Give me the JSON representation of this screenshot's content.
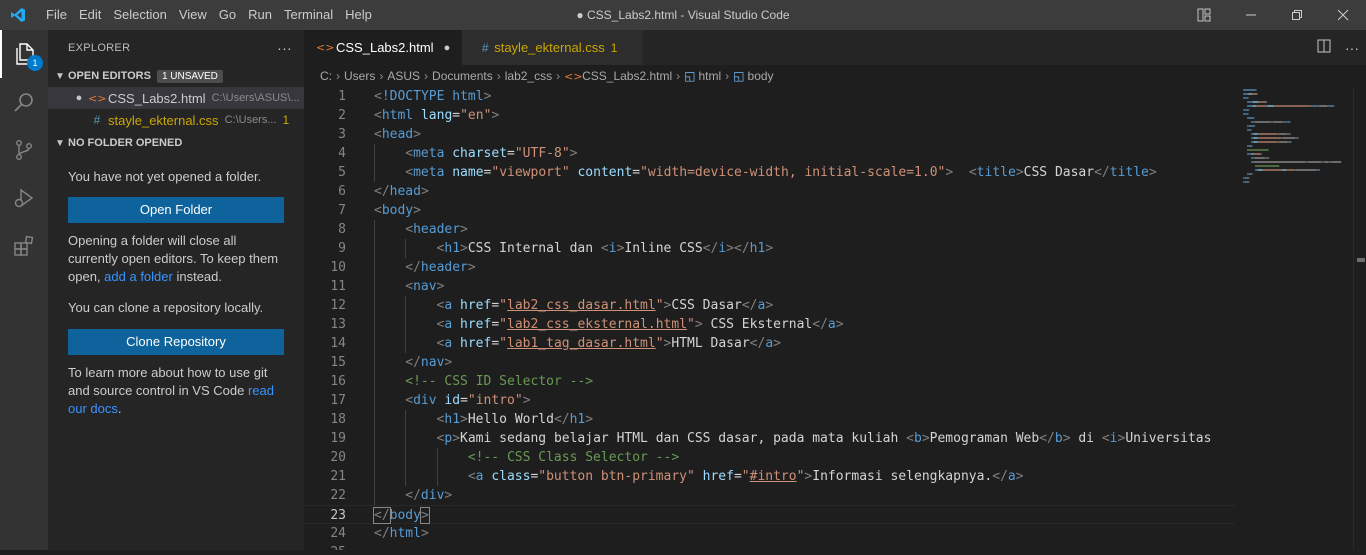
{
  "menu": [
    "File",
    "Edit",
    "Selection",
    "View",
    "Go",
    "Run",
    "Terminal",
    "Help"
  ],
  "window_title": "● CSS_Labs2.html - Visual Studio Code",
  "activity": {
    "explorer_badge": "1"
  },
  "sidebar": {
    "title": "EXPLORER",
    "more": "···",
    "open_editors": {
      "label": "OPEN EDITORS",
      "badge": "1 UNSAVED",
      "items": [
        {
          "name": "CSS_Labs2.html",
          "path": "C:\\Users\\ASUS\\..."
        },
        {
          "name": "stayle_ekternal.css",
          "path": "C:\\Users...",
          "problems": "1"
        }
      ]
    },
    "no_folder": {
      "label": "NO FOLDER OPENED",
      "msg1": "You have not yet opened a folder.",
      "open_btn": "Open Folder",
      "msg2_a": "Opening a folder will close all currently open editors. To keep them open,",
      "msg2_link": "add a folder",
      "msg2_b": "instead.",
      "msg3": "You can clone a repository locally.",
      "clone_btn": "Clone Repository",
      "msg4_a": "To learn more about how to use git and source control in VS Code",
      "msg4_link": "read our docs",
      "msg4_b": "."
    }
  },
  "tabs": [
    {
      "label": "CSS_Labs2.html",
      "state": "●"
    },
    {
      "label": "stayle_ekternal.css",
      "problems": "1"
    }
  ],
  "breadcrumbs": [
    "C:",
    "Users",
    "ASUS",
    "Documents",
    "lab2_css",
    "CSS_Labs2.html",
    "html",
    "body"
  ],
  "editor": {
    "current_line": 23,
    "lines": [
      {
        "n": "1",
        "indent": 0,
        "tokens": [
          [
            "br",
            "<"
          ],
          [
            "doc",
            "!DOCTYPE "
          ],
          [
            "tag",
            "html"
          ],
          [
            "br",
            ">"
          ]
        ]
      },
      {
        "n": "2",
        "indent": 0,
        "tokens": [
          [
            "br",
            "<"
          ],
          [
            "tag",
            "html"
          ],
          [
            "txt",
            " "
          ],
          [
            "attr",
            "lang"
          ],
          [
            "txt",
            "="
          ],
          [
            "str",
            "\"en\""
          ],
          [
            "br",
            ">"
          ]
        ]
      },
      {
        "n": "3",
        "indent": 0,
        "tokens": [
          [
            "br",
            "<"
          ],
          [
            "tag",
            "head"
          ],
          [
            "br",
            ">"
          ]
        ]
      },
      {
        "n": "4",
        "indent": 1,
        "tokens": [
          [
            "br",
            "<"
          ],
          [
            "tag",
            "meta"
          ],
          [
            "txt",
            " "
          ],
          [
            "attr",
            "charset"
          ],
          [
            "txt",
            "="
          ],
          [
            "str",
            "\"UTF-8\""
          ],
          [
            "br",
            ">"
          ]
        ]
      },
      {
        "n": "5",
        "indent": 1,
        "tokens": [
          [
            "br",
            "<"
          ],
          [
            "tag",
            "meta"
          ],
          [
            "txt",
            " "
          ],
          [
            "attr",
            "name"
          ],
          [
            "txt",
            "="
          ],
          [
            "str",
            "\"viewport\""
          ],
          [
            "txt",
            " "
          ],
          [
            "attr",
            "content"
          ],
          [
            "txt",
            "="
          ],
          [
            "str",
            "\"width=device-width, initial-scale=1.0\""
          ],
          [
            "br",
            ">"
          ],
          [
            "txt",
            "  "
          ],
          [
            "br",
            "<"
          ],
          [
            "tag",
            "title"
          ],
          [
            "br",
            ">"
          ],
          [
            "txt",
            "CSS Dasar"
          ],
          [
            "br",
            "</"
          ],
          [
            "tag",
            "title"
          ],
          [
            "br",
            ">"
          ]
        ]
      },
      {
        "n": "6",
        "indent": 0,
        "tokens": [
          [
            "br",
            "</"
          ],
          [
            "tag",
            "head"
          ],
          [
            "br",
            ">"
          ]
        ]
      },
      {
        "n": "7",
        "indent": 0,
        "tokens": [
          [
            "br",
            "<"
          ],
          [
            "tag",
            "body"
          ],
          [
            "br",
            ">"
          ]
        ]
      },
      {
        "n": "8",
        "indent": 1,
        "tokens": [
          [
            "br",
            "<"
          ],
          [
            "tag",
            "header"
          ],
          [
            "br",
            ">"
          ]
        ]
      },
      {
        "n": "9",
        "indent": 2,
        "tokens": [
          [
            "br",
            "<"
          ],
          [
            "tag",
            "h1"
          ],
          [
            "br",
            ">"
          ],
          [
            "txt",
            "CSS Internal dan "
          ],
          [
            "br",
            "<"
          ],
          [
            "tag",
            "i"
          ],
          [
            "br",
            ">"
          ],
          [
            "txt",
            "Inline CSS"
          ],
          [
            "br",
            "</"
          ],
          [
            "tag",
            "i"
          ],
          [
            "br",
            ">"
          ],
          [
            "br",
            "</"
          ],
          [
            "tag",
            "h1"
          ],
          [
            "br",
            ">"
          ]
        ]
      },
      {
        "n": "10",
        "indent": 1,
        "tokens": [
          [
            "br",
            "</"
          ],
          [
            "tag",
            "header"
          ],
          [
            "br",
            ">"
          ]
        ]
      },
      {
        "n": "11",
        "indent": 1,
        "tokens": [
          [
            "br",
            "<"
          ],
          [
            "tag",
            "nav"
          ],
          [
            "br",
            ">"
          ]
        ]
      },
      {
        "n": "12",
        "indent": 2,
        "tokens": [
          [
            "br",
            "<"
          ],
          [
            "tag",
            "a"
          ],
          [
            "txt",
            " "
          ],
          [
            "attr",
            "href"
          ],
          [
            "txt",
            "="
          ],
          [
            "str",
            "\""
          ],
          [
            "stru",
            "lab2_css_dasar.html"
          ],
          [
            "str",
            "\""
          ],
          [
            "br",
            ">"
          ],
          [
            "txt",
            "CSS Dasar"
          ],
          [
            "br",
            "</"
          ],
          [
            "tag",
            "a"
          ],
          [
            "br",
            ">"
          ]
        ]
      },
      {
        "n": "13",
        "indent": 2,
        "tokens": [
          [
            "br",
            "<"
          ],
          [
            "tag",
            "a"
          ],
          [
            "txt",
            " "
          ],
          [
            "attr",
            "href"
          ],
          [
            "txt",
            "="
          ],
          [
            "str",
            "\""
          ],
          [
            "stru",
            "lab2_css_eksternal.html"
          ],
          [
            "str",
            "\""
          ],
          [
            "br",
            ">"
          ],
          [
            "txt",
            " CSS Eksternal"
          ],
          [
            "br",
            "</"
          ],
          [
            "tag",
            "a"
          ],
          [
            "br",
            ">"
          ]
        ]
      },
      {
        "n": "14",
        "indent": 2,
        "tokens": [
          [
            "br",
            "<"
          ],
          [
            "tag",
            "a"
          ],
          [
            "txt",
            " "
          ],
          [
            "attr",
            "href"
          ],
          [
            "txt",
            "="
          ],
          [
            "str",
            "\""
          ],
          [
            "stru",
            "lab1_tag_dasar.html"
          ],
          [
            "str",
            "\""
          ],
          [
            "br",
            ">"
          ],
          [
            "txt",
            "HTML Dasar"
          ],
          [
            "br",
            "</"
          ],
          [
            "tag",
            "a"
          ],
          [
            "br",
            ">"
          ]
        ]
      },
      {
        "n": "15",
        "indent": 1,
        "tokens": [
          [
            "br",
            "</"
          ],
          [
            "tag",
            "nav"
          ],
          [
            "br",
            ">"
          ]
        ]
      },
      {
        "n": "16",
        "indent": 1,
        "tokens": [
          [
            "com",
            "<!-- CSS ID Selector -->"
          ]
        ]
      },
      {
        "n": "17",
        "indent": 1,
        "tokens": [
          [
            "br",
            "<"
          ],
          [
            "tag",
            "div"
          ],
          [
            "txt",
            " "
          ],
          [
            "attr",
            "id"
          ],
          [
            "txt",
            "="
          ],
          [
            "str",
            "\"intro\""
          ],
          [
            "br",
            ">"
          ]
        ]
      },
      {
        "n": "18",
        "indent": 2,
        "tokens": [
          [
            "br",
            "<"
          ],
          [
            "tag",
            "h1"
          ],
          [
            "br",
            ">"
          ],
          [
            "txt",
            "Hello World"
          ],
          [
            "br",
            "</"
          ],
          [
            "tag",
            "h1"
          ],
          [
            "br",
            ">"
          ]
        ]
      },
      {
        "n": "19",
        "indent": 2,
        "tokens": [
          [
            "br",
            "<"
          ],
          [
            "tag",
            "p"
          ],
          [
            "br",
            ">"
          ],
          [
            "txt",
            "Kami sedang belajar HTML dan CSS dasar, pada mata kuliah "
          ],
          [
            "br",
            "<"
          ],
          [
            "tag",
            "b"
          ],
          [
            "br",
            ">"
          ],
          [
            "txt",
            "Pemograman Web"
          ],
          [
            "br",
            "</"
          ],
          [
            "tag",
            "b"
          ],
          [
            "br",
            ">"
          ],
          [
            "txt",
            " di "
          ],
          [
            "br",
            "<"
          ],
          [
            "tag",
            "i"
          ],
          [
            "br",
            ">"
          ],
          [
            "txt",
            "Universitas"
          ]
        ]
      },
      {
        "n": "20",
        "indent": 3,
        "tokens": [
          [
            "com",
            "<!-- CSS Class Selector -->"
          ]
        ]
      },
      {
        "n": "21",
        "indent": 3,
        "tokens": [
          [
            "br",
            "<"
          ],
          [
            "tag",
            "a"
          ],
          [
            "txt",
            " "
          ],
          [
            "attr",
            "class"
          ],
          [
            "txt",
            "="
          ],
          [
            "str",
            "\"button btn-primary\""
          ],
          [
            "txt",
            " "
          ],
          [
            "attr",
            "href"
          ],
          [
            "txt",
            "="
          ],
          [
            "str",
            "\""
          ],
          [
            "stru",
            "#intro"
          ],
          [
            "str",
            "\""
          ],
          [
            "br",
            ">"
          ],
          [
            "txt",
            "Informasi selengkapnya."
          ],
          [
            "br",
            "</"
          ],
          [
            "tag",
            "a"
          ],
          [
            "br",
            ">"
          ]
        ]
      },
      {
        "n": "22",
        "indent": 1,
        "tokens": [
          [
            "br",
            "</"
          ],
          [
            "tag",
            "div"
          ],
          [
            "br",
            ">"
          ]
        ]
      },
      {
        "n": "23",
        "indent": 0,
        "tokens": [
          [
            "brh",
            "</"
          ],
          [
            "tag",
            "body"
          ],
          [
            "brh",
            ">"
          ]
        ]
      },
      {
        "n": "24",
        "indent": 0,
        "tokens": [
          [
            "br",
            "</"
          ],
          [
            "tag",
            "html"
          ],
          [
            "br",
            ">"
          ]
        ]
      },
      {
        "n": "25",
        "indent": 0,
        "tokens": []
      }
    ]
  }
}
